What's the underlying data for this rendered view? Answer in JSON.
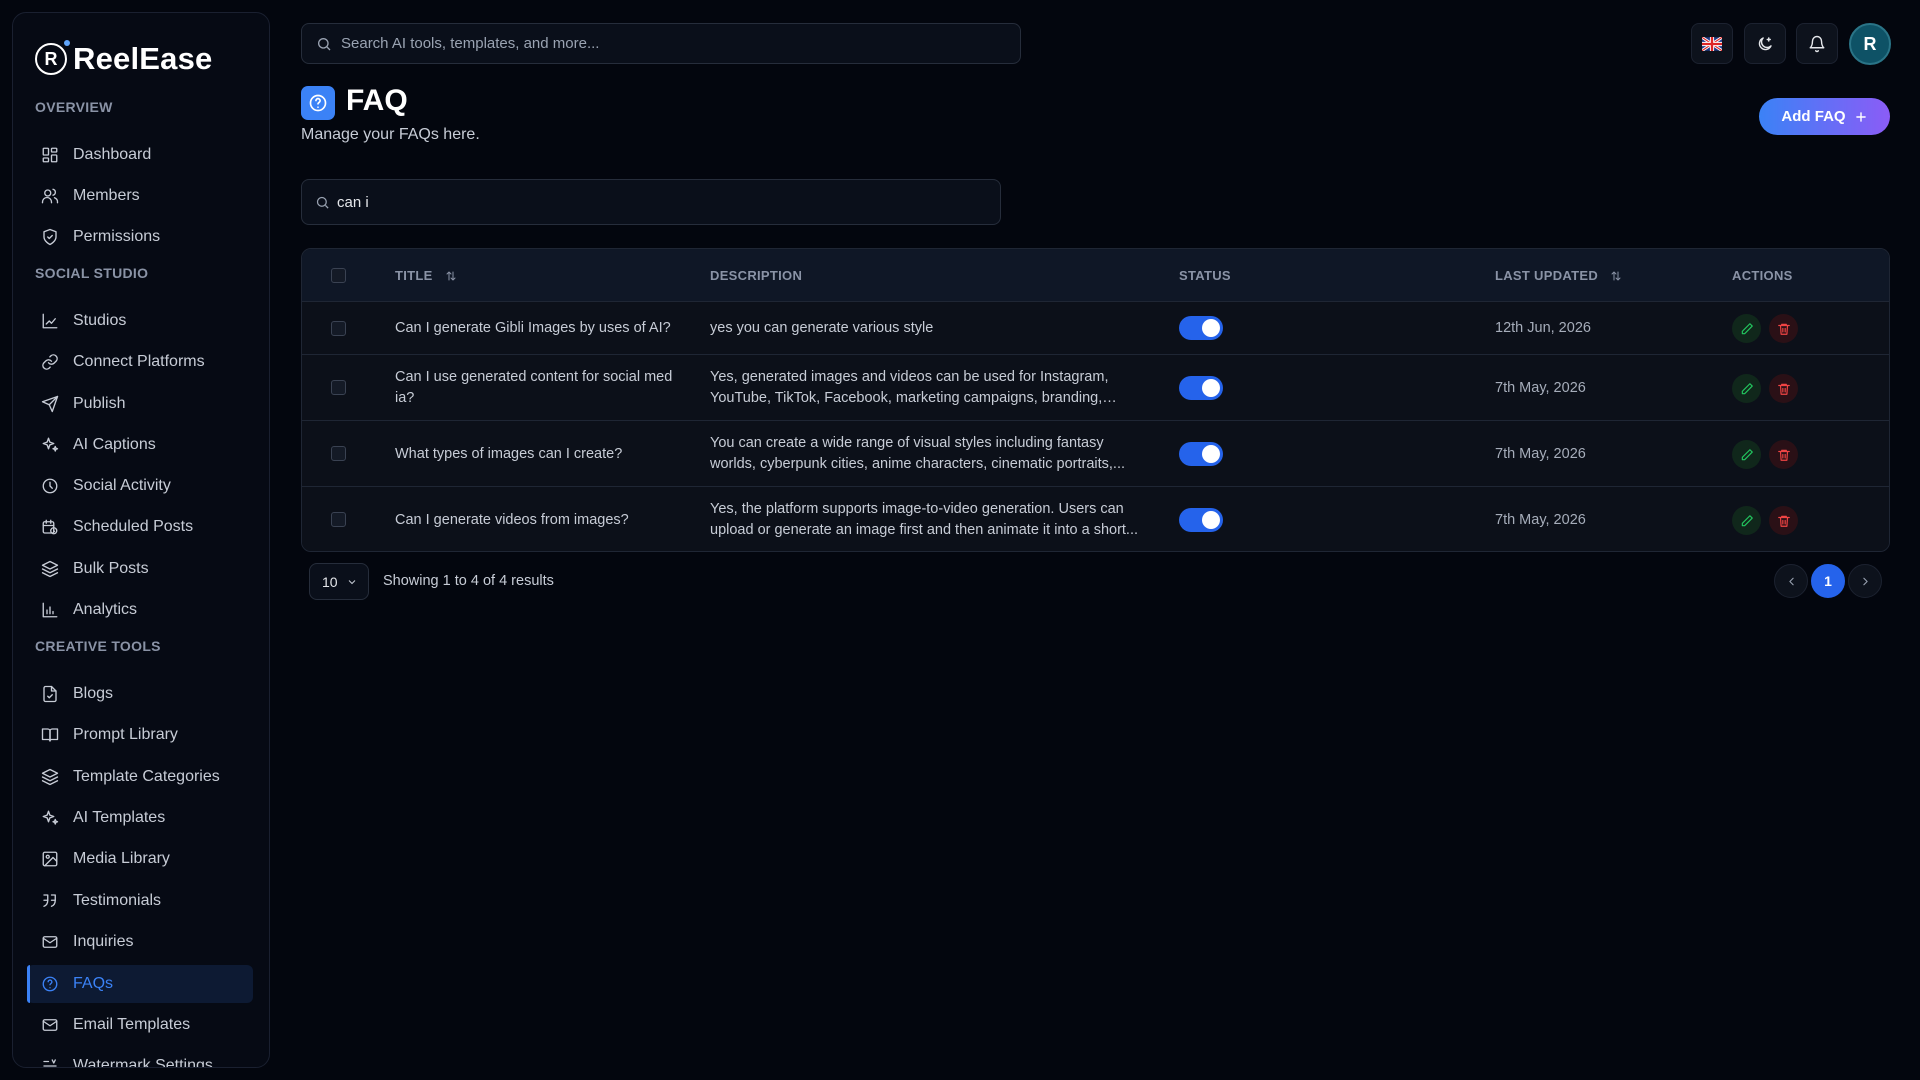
{
  "app": {
    "name": "ReelEase"
  },
  "sidebar": {
    "sections": [
      {
        "label": "OVERVIEW"
      },
      {
        "label": "SOCIAL STUDIO"
      },
      {
        "label": "CREATIVE TOOLS"
      }
    ],
    "items": [
      {
        "label": "Dashboard",
        "icon": "dashboard-icon"
      },
      {
        "label": "Members",
        "icon": "users-icon"
      },
      {
        "label": "Permissions",
        "icon": "shield-icon"
      },
      {
        "label": "Studios",
        "icon": "chart-icon"
      },
      {
        "label": "Connect Platforms",
        "icon": "link-icon"
      },
      {
        "label": "Publish",
        "icon": "send-icon"
      },
      {
        "label": "AI Captions",
        "icon": "sparkles-icon"
      },
      {
        "label": "Social Activity",
        "icon": "clock-icon"
      },
      {
        "label": "Scheduled Posts",
        "icon": "calendar-clock-icon"
      },
      {
        "label": "Bulk Posts",
        "icon": "layers-icon"
      },
      {
        "label": "Analytics",
        "icon": "bar-chart-icon"
      },
      {
        "label": "Blogs",
        "icon": "file-icon"
      },
      {
        "label": "Prompt Library",
        "icon": "book-icon"
      },
      {
        "label": "Template Categories",
        "icon": "layers-icon"
      },
      {
        "label": "AI Templates",
        "icon": "sparkles-icon"
      },
      {
        "label": "Media Library",
        "icon": "image-icon"
      },
      {
        "label": "Testimonials",
        "icon": "quote-icon"
      },
      {
        "label": "Inquiries",
        "icon": "mail-icon"
      },
      {
        "label": "FAQs",
        "icon": "help-circle-icon",
        "active": true
      },
      {
        "label": "Email Templates",
        "icon": "mail-icon"
      },
      {
        "label": "Watermark Settings",
        "icon": "text-settings-icon"
      }
    ]
  },
  "topbar": {
    "search_placeholder": "Search AI tools, templates, and more...",
    "avatar_initial": "R",
    "icons": [
      "uk-flag-icon",
      "theme-toggle-icon",
      "bell-icon"
    ]
  },
  "page": {
    "title": "FAQ",
    "subtitle": "Manage your FAQs here.",
    "add_button": "Add FAQ",
    "filter_value": "can i"
  },
  "table": {
    "headers": {
      "title": "TITLE",
      "description": "DESCRIPTION",
      "status": "STATUS",
      "last_updated": "LAST UPDATED",
      "actions": "ACTIONS"
    },
    "rows": [
      {
        "title": "Can I generate Gibli Images by uses of AI?",
        "description": "yes you can generate various style",
        "status_enabled": true,
        "last_updated": "12th Jun, 2026"
      },
      {
        "title": "Can I use generated content for social med ia?",
        "description": "Yes, generated images and videos can be used for Instagram, YouTube, TikTok, Facebook, marketing campaigns, branding, and...",
        "status_enabled": true,
        "last_updated": "7th May, 2026"
      },
      {
        "title": "What types of images can I create?",
        "description": "You can create a wide range of visual styles including fantasy worlds, cyberpunk cities, anime characters, cinematic portraits,...",
        "status_enabled": true,
        "last_updated": "7th May, 2026"
      },
      {
        "title": "Can I generate videos from images?",
        "description": "Yes, the platform supports image-to-video generation. Users can upload or generate an image first and then animate it into a short...",
        "status_enabled": true,
        "last_updated": "7th May, 2026"
      }
    ]
  },
  "footer": {
    "page_size": "10",
    "showing": "Showing 1 to 4 of 4 results",
    "current_page": "1"
  },
  "colors": {
    "accent": "#3b82f6",
    "background": "#03060e",
    "edit": "#22c55e",
    "delete": "#ef4444"
  }
}
